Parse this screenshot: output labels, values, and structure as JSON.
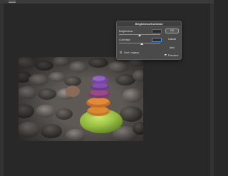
{
  "dialog": {
    "title": "Brightness/Contrast",
    "brightness_label": "Brightness:",
    "brightness_value": "",
    "contrast_label": "Contrast:",
    "contrast_value": "",
    "brightness_level": 0.5,
    "contrast_level": 0.55,
    "use_legacy_label": "Use Legacy",
    "use_legacy_checked": false,
    "ok_label": "OK",
    "cancel_label": "Cancel",
    "auto_label": "Auto",
    "preview_label": "Preview",
    "preview_checked": true
  },
  "colors": {
    "workspace": "#282828",
    "dialog_bg": "#4a4a4a",
    "focus": "#4a90e2"
  },
  "icons": {
    "menu": "panel-menu-icon"
  }
}
